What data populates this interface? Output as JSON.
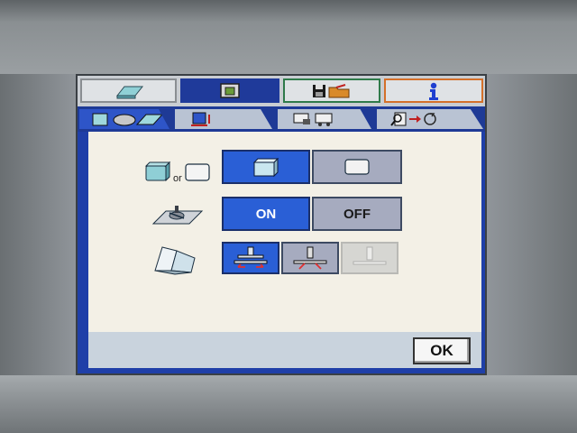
{
  "top_tabs": [
    {
      "icon": "paper-stack-icon",
      "active": false
    },
    {
      "icon": "screen-icon",
      "active": true
    },
    {
      "icon": "save-open-folder-icon",
      "active": false
    },
    {
      "icon": "info-icon",
      "active": false
    }
  ],
  "sub_tabs": [
    {
      "icon": "booklet-layout-icon",
      "active": true
    },
    {
      "icon": "position-adjust-icon",
      "active": false
    },
    {
      "icon": "transport-icon",
      "active": false
    },
    {
      "icon": "search-refresh-icon",
      "active": false
    }
  ],
  "rows": {
    "row1": {
      "or_text": "or",
      "options": [
        {
          "icon": "block-3d-icon",
          "selected": true
        },
        {
          "icon": "block-flat-icon",
          "selected": false
        }
      ]
    },
    "row2": {
      "on_label": "ON",
      "off_label": "OFF",
      "selected": "ON"
    },
    "row3": {
      "options": [
        {
          "icon": "clamp-open-icon",
          "selected": true
        },
        {
          "icon": "clamp-close-icon",
          "selected": false
        },
        {
          "icon": "clamp-disabled-icon",
          "selected": false,
          "disabled": true
        }
      ]
    }
  },
  "footer": {
    "ok_label": "OK"
  },
  "colors": {
    "accent": "#2a5fd6",
    "screen_frame": "#1f3fa8",
    "content_bg": "#f3f0e6",
    "tab_info_border": "#d4702a",
    "tab_save_border": "#2f7a4a"
  }
}
